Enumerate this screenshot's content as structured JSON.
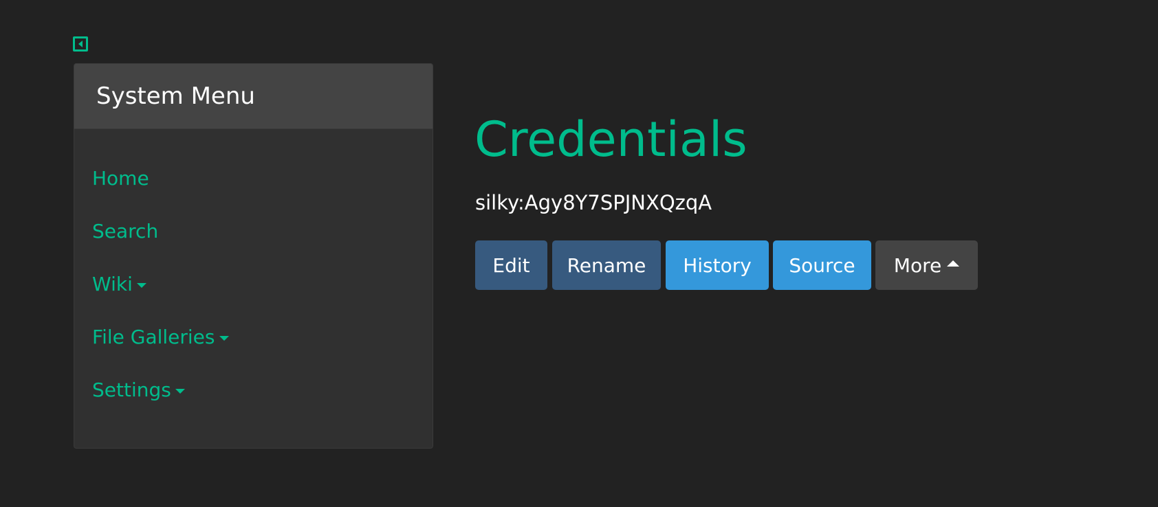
{
  "sidebar": {
    "toggle_icon": "sidebar-collapse-icon",
    "title": "System Menu",
    "items": [
      {
        "label": "Home",
        "has_dropdown": false
      },
      {
        "label": "Search",
        "has_dropdown": false
      },
      {
        "label": "Wiki",
        "has_dropdown": true
      },
      {
        "label": "File Galleries",
        "has_dropdown": true
      },
      {
        "label": "Settings",
        "has_dropdown": true
      }
    ]
  },
  "page": {
    "title": "Credentials",
    "subtitle": "silky:Agy8Y7SPJNXQzqA"
  },
  "actions": {
    "edit": "Edit",
    "rename": "Rename",
    "history": "History",
    "source": "Source",
    "more": "More"
  },
  "colors": {
    "background": "#222222",
    "accent": "#00bc8c",
    "panel": "#303030",
    "panel_heading": "#444444",
    "button_primary": "#375a7f",
    "button_info": "#3498db",
    "button_secondary": "#444444"
  }
}
